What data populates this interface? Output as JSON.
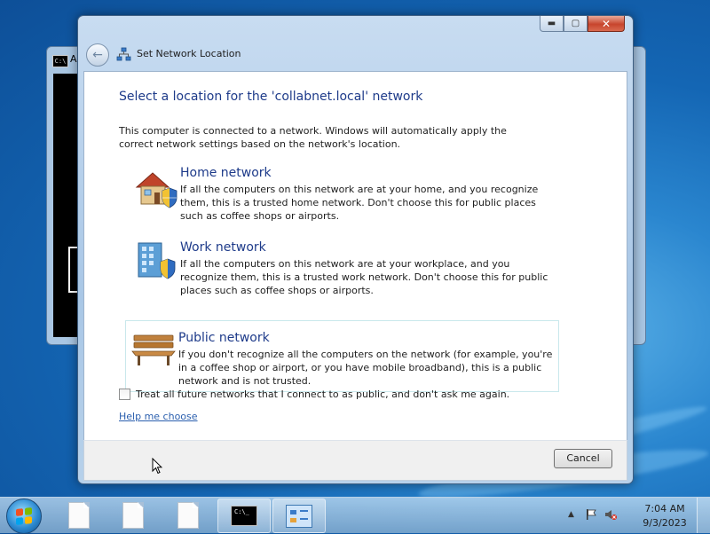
{
  "console_window": {
    "icon_text": "C:\\",
    "title_letter": "A"
  },
  "dialog": {
    "title": "Set Network Location",
    "heading": "Select a location for the 'collabnet.local' network",
    "description": "This computer is connected to a network. Windows will automatically apply the correct network settings based on the network's location.",
    "window_buttons": {
      "minimize": "▬",
      "maximize": "▢",
      "close": "✕"
    },
    "options": [
      {
        "title": "Home network",
        "text": "If all the computers on this network are at your home, and you recognize them, this is a trusted home network.  Don't choose this for public places such as coffee shops or airports.",
        "icon": "house-shield-icon"
      },
      {
        "title": "Work network",
        "text": "If all the computers on this network are at your workplace, and you recognize them, this is a trusted work network.  Don't choose this for public places such as coffee shops or airports.",
        "icon": "building-shield-icon"
      },
      {
        "title": "Public network",
        "text": "If you don't recognize all the computers on the network (for example, you're in a coffee shop or airport, or you have mobile broadband), this is a public network and is not trusted.",
        "icon": "park-bench-icon"
      }
    ],
    "checkbox_label": "Treat all future networks that I connect to as public, and don't ask me again.",
    "checkbox_checked": false,
    "help_link": "Help me choose",
    "cancel_label": "Cancel"
  },
  "taskbar": {
    "cmd_text": "C:\\_",
    "clock_time": "7:04 AM",
    "clock_date": "9/3/2023"
  },
  "colors": {
    "accent_text": "#1e3b8a",
    "link": "#2b5fae",
    "close_button": "#c7452d"
  }
}
